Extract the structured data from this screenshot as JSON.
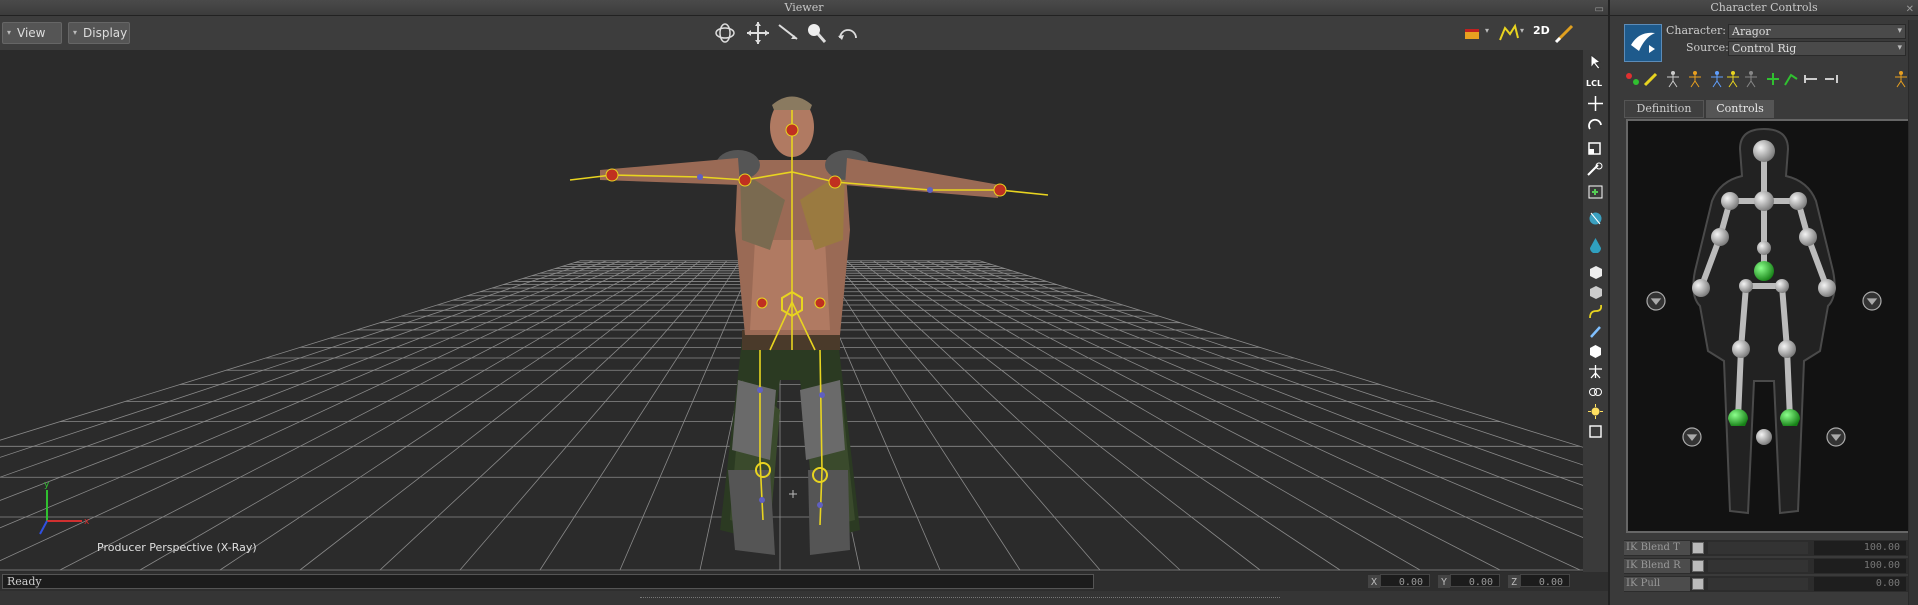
{
  "viewer": {
    "title": "Viewer",
    "menu": {
      "view": "View",
      "display": "Display"
    },
    "toolbar_icons": [
      "orbit-icon",
      "pan-icon",
      "drag-icon",
      "zoom-icon",
      "undo-icon"
    ],
    "right_icons": [
      "render-icon",
      "curve-icon",
      "2d-icon",
      "brush-icon"
    ],
    "viewport_label": "Producer Perspective (X-Ray)",
    "side_tools": [
      "select-icon",
      "lcl-icon",
      "translate-icon",
      "rotate-icon",
      "scale-icon",
      "manipulate-icon",
      "keyframe-icon",
      "globe-icon",
      "drop-icon",
      "cube-icon",
      "box-icon",
      "curve-icon",
      "paint-icon",
      "hexagon-icon",
      "skeleton-icon",
      "link-icon",
      "light-icon",
      "frame-icon"
    ],
    "side_labels": {
      "lcl": "LCL"
    }
  },
  "status": {
    "text": "Ready",
    "x_label": "X",
    "x_val": "0.00",
    "y_label": "Y",
    "y_val": "0.00",
    "z_label": "Z",
    "z_val": "0.00"
  },
  "character_controls": {
    "title": "Character Controls",
    "character_label": "Character:",
    "character_value": "Aragor",
    "source_label": "Source:",
    "source_value": "Control Rig",
    "tabs": {
      "definition": "Definition",
      "controls": "Controls"
    },
    "properties": [
      {
        "label": "IK Blend T",
        "value": "100.00"
      },
      {
        "label": "IK Blend R",
        "value": "100.00"
      },
      {
        "label": "IK Pull",
        "value": "0.00"
      }
    ]
  },
  "colors": {
    "accent_yellow": "#e8d420",
    "green_effector": "#30c030",
    "grid": "#9a9a9a"
  }
}
